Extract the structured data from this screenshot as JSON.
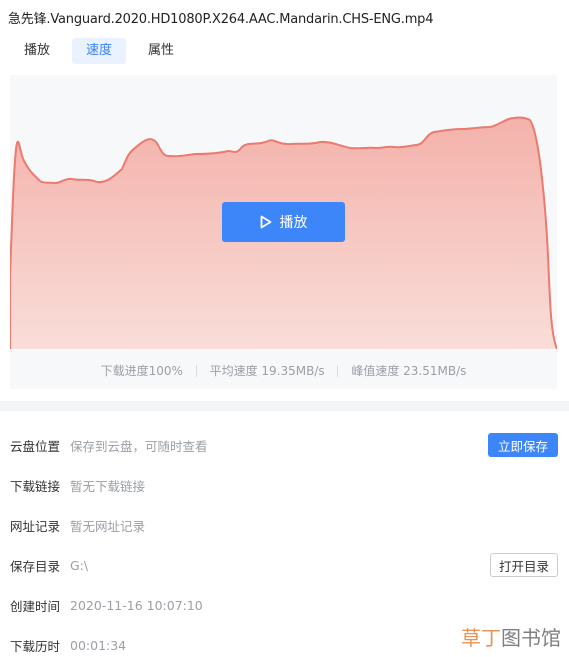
{
  "window": {
    "title": "急先锋.Vanguard.2020.HD1080P.X264.AAC.Mandarin.CHS-ENG.mp4"
  },
  "tabs": [
    {
      "label": "播放",
      "active": false
    },
    {
      "label": "速度",
      "active": true
    },
    {
      "label": "属性",
      "active": false
    }
  ],
  "player": {
    "play_label": "播放",
    "play_icon": "play-triangle-icon"
  },
  "speed_chart": {
    "stats": {
      "progress": "下载进度100%",
      "avg": "平均速度 19.35MB/s",
      "peak": "峰值速度 23.51MB/s"
    },
    "fill_color": "#f6b9b2",
    "line_color": "#ec7a6f"
  },
  "info": {
    "cloud_label": "云盘位置",
    "cloud_value": "保存到云盘，可随时查看",
    "cloud_button": "立即保存",
    "link_label": "下载链接",
    "link_value": "暂无下载链接",
    "url_label": "网址记录",
    "url_value": "暂无网址记录",
    "dir_label": "保存目录",
    "dir_value": "G:\\",
    "dir_button": "打开目录",
    "created_label": "创建时间",
    "created_value": "2020-11-16 10:07:10",
    "duration_label": "下载历时",
    "duration_value": "00:01:34"
  },
  "watermark": {
    "text_a": "草丁",
    "text_b": "图书馆"
  }
}
